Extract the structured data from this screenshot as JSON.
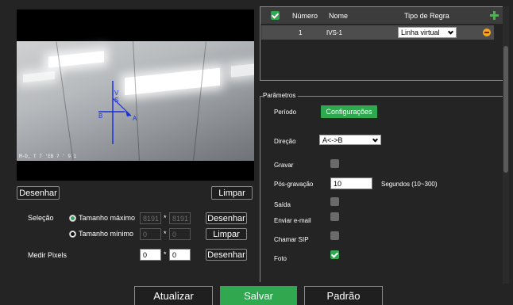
{
  "video": {
    "overlay_letters": {
      "v": "V",
      "s": "S",
      "b": "B",
      "a": "A"
    },
    "osd_text": "M-D, T 7 'EB 7 ' 9 1"
  },
  "left_controls": {
    "draw_button": "Desenhar",
    "clear_button": "Limpar",
    "selection_label": "Seleção",
    "max_size_label": "Tamanho máximo",
    "min_size_label": "Tamanho mínimo",
    "max_w": "8191",
    "max_h": "8191",
    "min_w": "0",
    "min_h": "0",
    "max_draw_button": "Desenhar",
    "min_clear_button": "Limpar",
    "measure_label": "Medir Pixels",
    "measure_w": "0",
    "measure_h": "0",
    "measure_draw_button": "Desenhar",
    "times": "*"
  },
  "rules_table": {
    "headers": {
      "number": "Número",
      "name": "Nome",
      "rule_type": "Tipo de Regra"
    },
    "rows": [
      {
        "number": "1",
        "name": "IVS-1",
        "rule_type": "Linha virtual"
      }
    ],
    "colors": {
      "check": "#2fa84f",
      "add": "#4caf50",
      "remove": "#f5a623"
    }
  },
  "params": {
    "title": "Parâmetros",
    "period_label": "Período",
    "config_button": "Configurações",
    "direction_label": "Direção",
    "direction_value": "A<->B",
    "record_label": "Gravar",
    "record_checked": false,
    "post_record_label": "Pós-gravação",
    "post_record_value": "10",
    "post_record_hint": "Segundos (10~300)",
    "output_label": "Saída",
    "output_checked": false,
    "email_label": "Enviar e-mail",
    "email_checked": false,
    "sip_label": "Chamar SIP",
    "sip_checked": false,
    "photo_label": "Foto",
    "photo_checked": true
  },
  "bottom": {
    "refresh_button": "Atualizar",
    "save_button": "Salvar",
    "default_button": "Padrão",
    "save_color": "#2fa84f"
  }
}
